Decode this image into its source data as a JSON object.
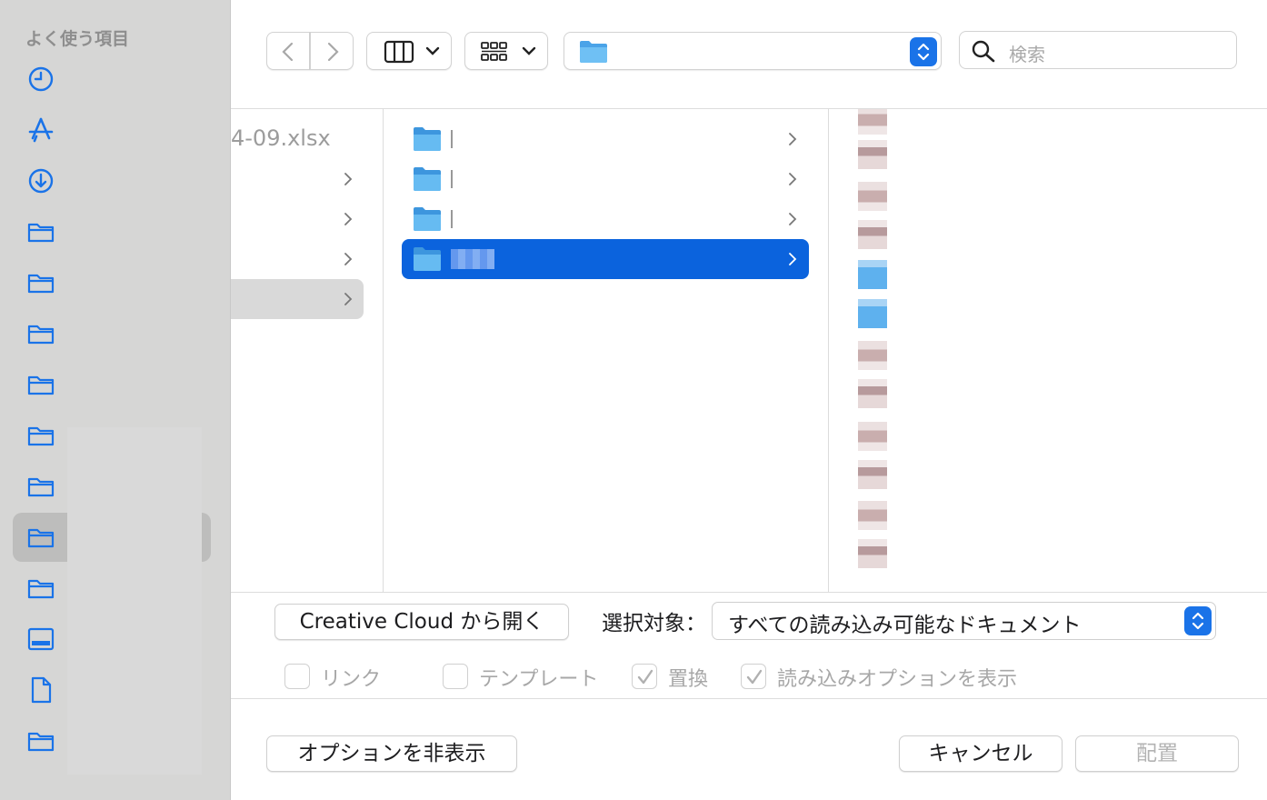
{
  "sidebar": {
    "heading": "よく使う項目",
    "items": [
      {
        "icon": "clock-icon"
      },
      {
        "icon": "applications-icon"
      },
      {
        "icon": "downloads-icon"
      },
      {
        "icon": "folder-icon"
      },
      {
        "icon": "folder-icon"
      },
      {
        "icon": "folder-icon"
      },
      {
        "icon": "folder-icon"
      },
      {
        "icon": "folder-icon"
      },
      {
        "icon": "folder-icon"
      },
      {
        "icon": "folder-icon",
        "selected": true
      },
      {
        "icon": "folder-icon"
      },
      {
        "icon": "desktop-icon"
      },
      {
        "icon": "document-icon"
      },
      {
        "icon": "folder-icon"
      }
    ]
  },
  "toolbar": {
    "path_label": "",
    "search_placeholder": "検索"
  },
  "browser": {
    "column1_filename": "4-09.xlsx",
    "column2_folders": [
      {
        "name": ""
      },
      {
        "name": ""
      },
      {
        "name": ""
      },
      {
        "name": "",
        "selected": true
      }
    ]
  },
  "options": {
    "open_from_cc": "Creative Cloud から開く",
    "select_label": "選択対象：",
    "select_value": "すべての読み込み可能なドキュメント",
    "checkboxes": [
      {
        "label": "リンク",
        "checked": false
      },
      {
        "label": "テンプレート",
        "checked": false
      },
      {
        "label": "置換",
        "checked": true
      },
      {
        "label": "読み込みオプションを表示",
        "checked": true
      }
    ]
  },
  "footer": {
    "hide_options": "オプションを非表示",
    "cancel": "キャンセル",
    "place": "配置"
  },
  "colors": {
    "accent": "#0b63dd",
    "sidebar_icon": "#1a73e8",
    "folder": "#5eb1ee"
  }
}
